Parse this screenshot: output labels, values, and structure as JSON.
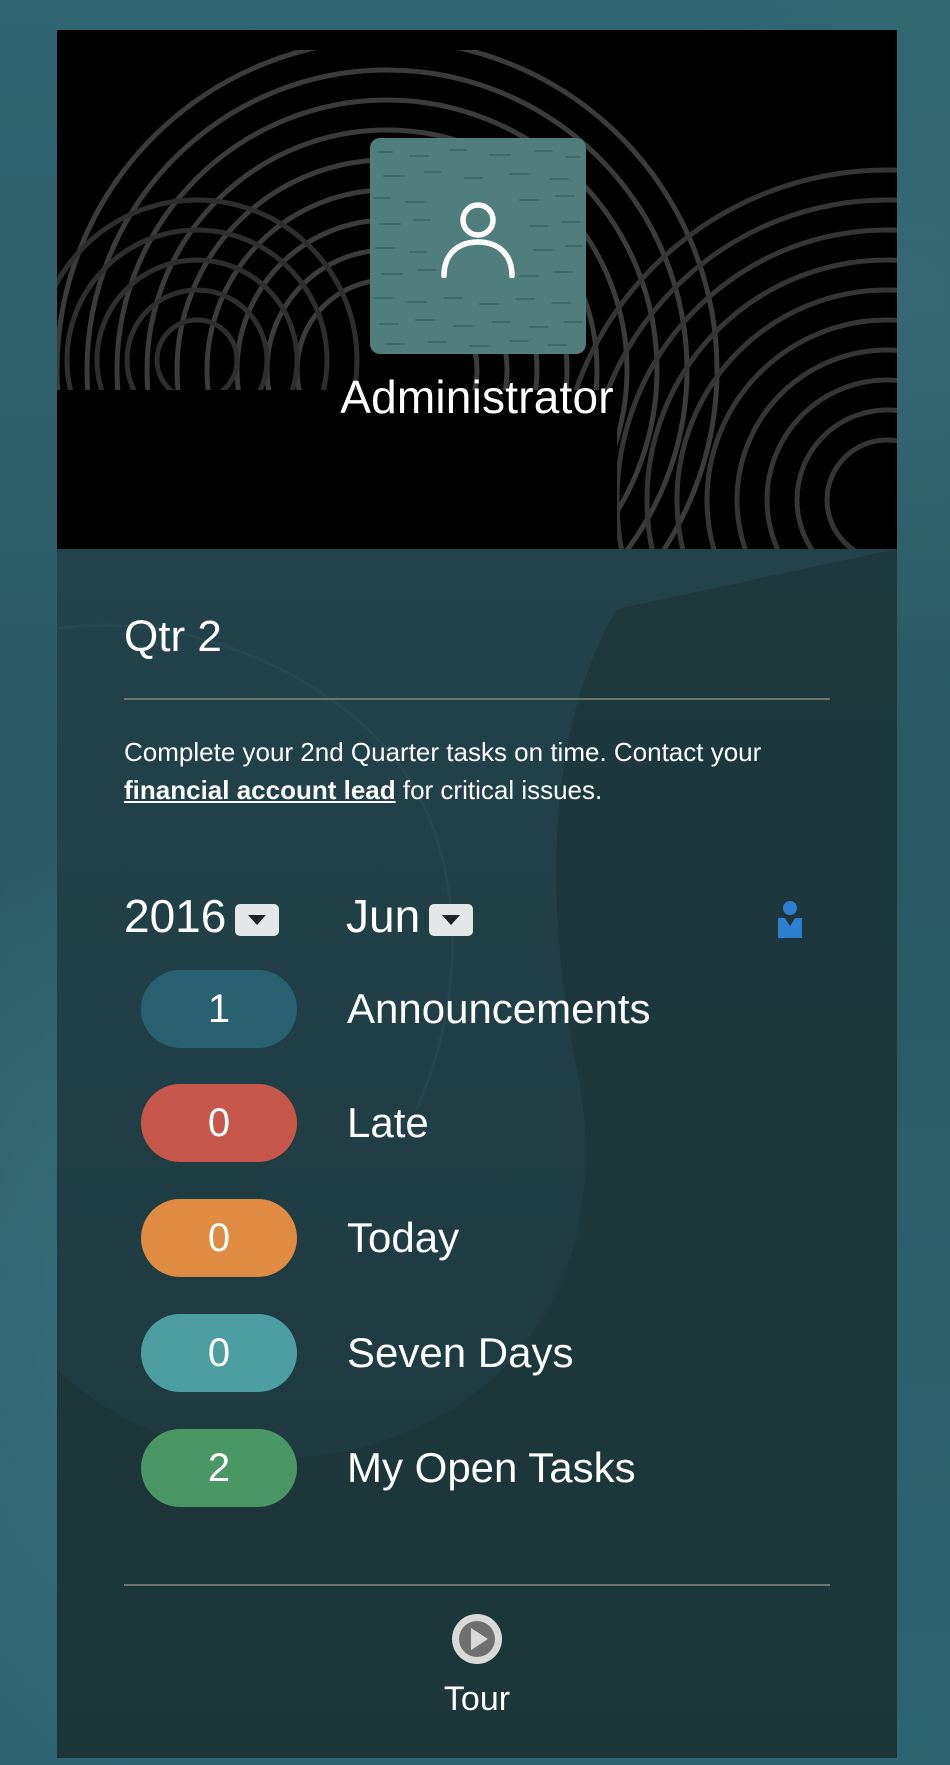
{
  "profile": {
    "name": "Administrator",
    "avatar_icon": "person-icon"
  },
  "period": {
    "title": "Qtr 2",
    "intro_before": "Complete your 2nd Quarter tasks on time. Contact your ",
    "intro_link": "financial account lead",
    "intro_after": " for critical issues."
  },
  "filters": {
    "year": "2016",
    "month": "Jun",
    "user_filter_icon": "user-filter-icon"
  },
  "stats": [
    {
      "count": "1",
      "label": "Announcements",
      "color": "#2a6170"
    },
    {
      "count": "0",
      "label": "Late",
      "color": "#c8574b"
    },
    {
      "count": "0",
      "label": "Today",
      "color": "#df8b42"
    },
    {
      "count": "0",
      "label": "Seven Days",
      "color": "#4c9ea1"
    },
    {
      "count": "2",
      "label": "My Open Tasks",
      "color": "#4a9664"
    }
  ],
  "tour": {
    "label": "Tour",
    "icon": "play-icon"
  },
  "colors": {
    "page_background": "#2f5c66",
    "card_background": "#1e3a40",
    "hero_background": "#000000",
    "avatar_tile": "#4f7e7d",
    "divider": "#6d756f",
    "user_filter_icon": "#2f7fd0"
  }
}
